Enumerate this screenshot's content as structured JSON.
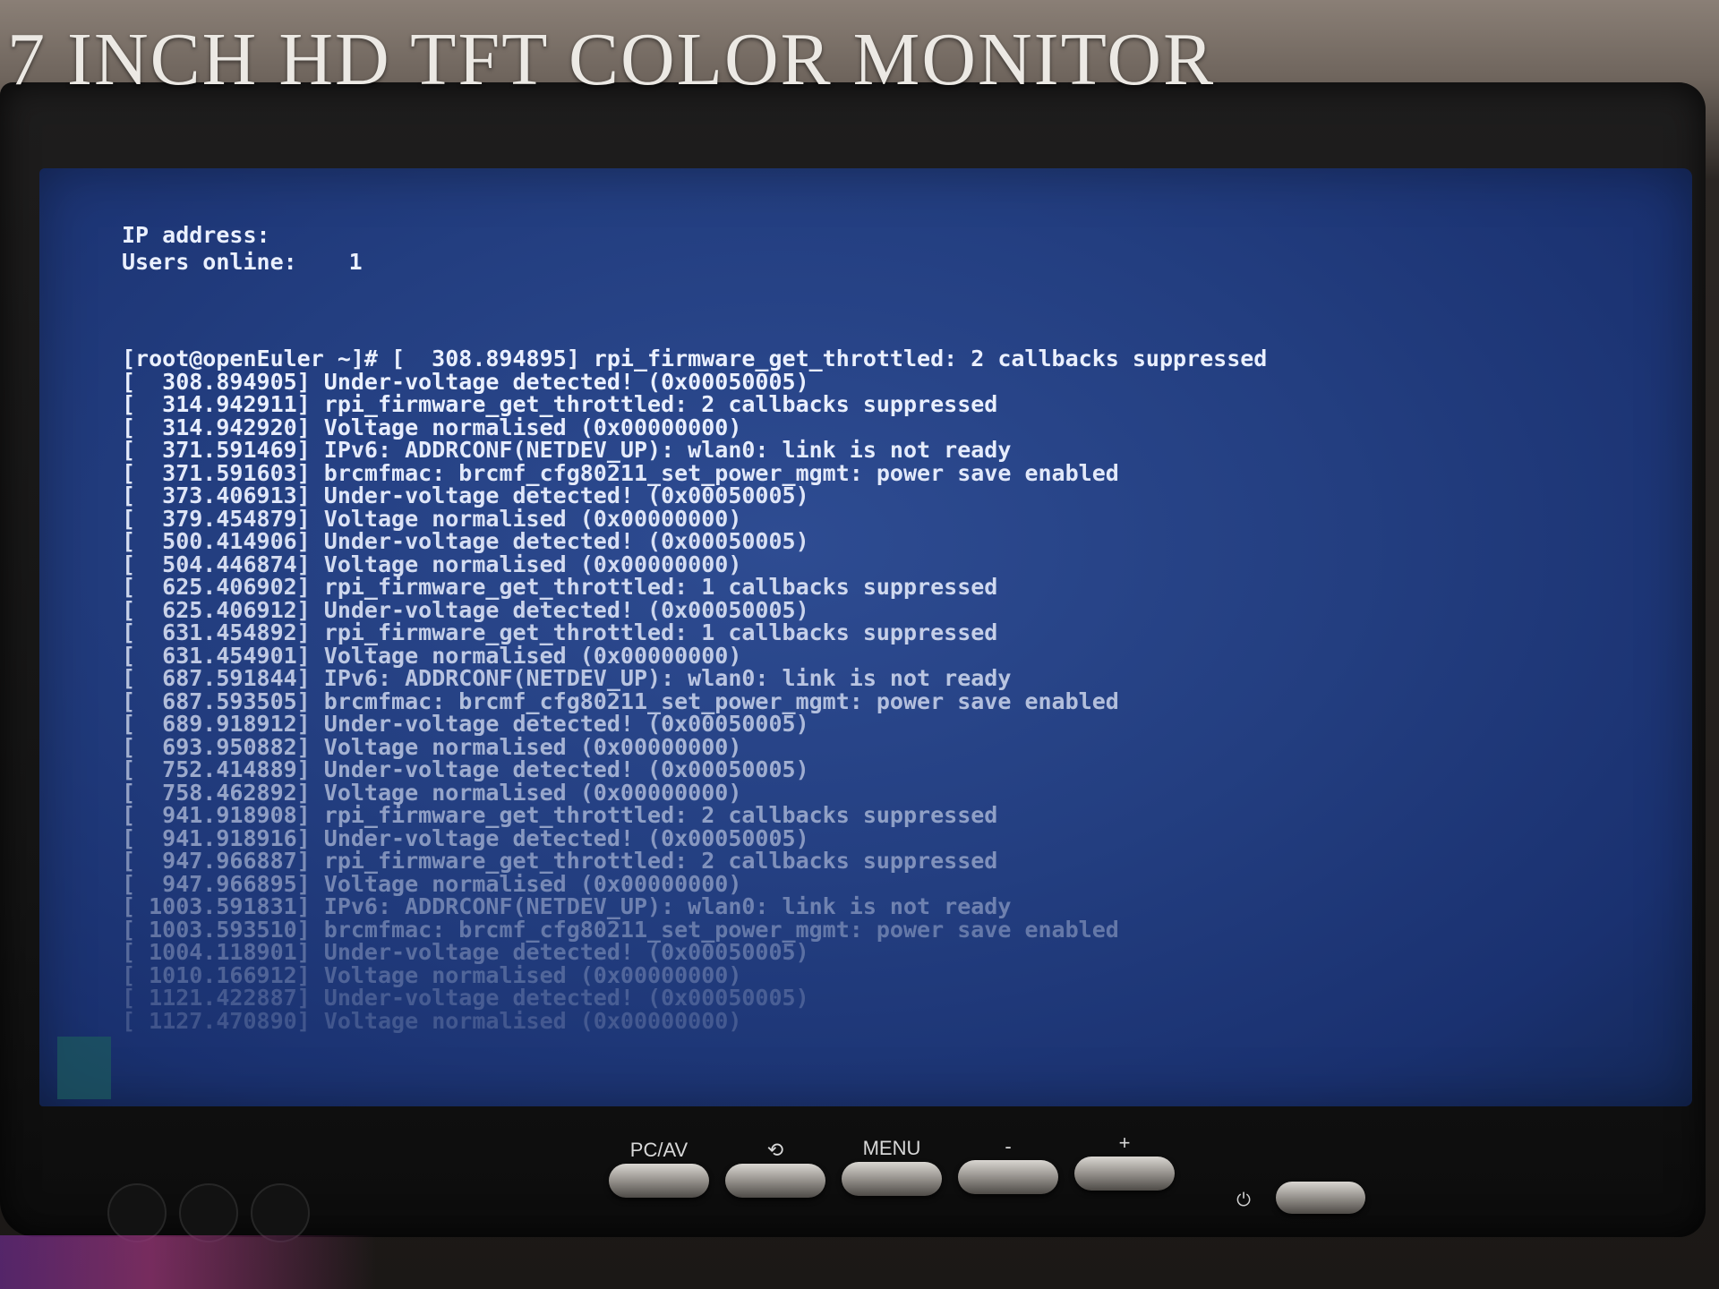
{
  "monitor": {
    "brand_title": "7 INCH HD TFT COLOR MONITOR"
  },
  "terminal": {
    "status": [
      {
        "label": "IP address:",
        "value": ""
      },
      {
        "label": "Users online:",
        "value": "1"
      }
    ],
    "prompt": "[root@openEuler ~]# [  308.894895] rpi_firmware_get_throttled: 2 callbacks suppressed",
    "log_lines": [
      {
        "ts": "[  308.894905]",
        "msg": "Under-voltage detected! (0x00050005)"
      },
      {
        "ts": "[  314.942911]",
        "msg": "rpi_firmware_get_throttled: 2 callbacks suppressed"
      },
      {
        "ts": "[  314.942920]",
        "msg": "Voltage normalised (0x00000000)"
      },
      {
        "ts": "[  371.591469]",
        "msg": "IPv6: ADDRCONF(NETDEV_UP): wlan0: link is not ready"
      },
      {
        "ts": "[  371.591603]",
        "msg": "brcmfmac: brcmf_cfg80211_set_power_mgmt: power save enabled"
      },
      {
        "ts": "[  373.406913]",
        "msg": "Under-voltage detected! (0x00050005)"
      },
      {
        "ts": "[  379.454879]",
        "msg": "Voltage normalised (0x00000000)"
      },
      {
        "ts": "[  500.414906]",
        "msg": "Under-voltage detected! (0x00050005)"
      },
      {
        "ts": "[  504.446874]",
        "msg": "Voltage normalised (0x00000000)"
      },
      {
        "ts": "[  625.406902]",
        "msg": "rpi_firmware_get_throttled: 1 callbacks suppressed"
      },
      {
        "ts": "[  625.406912]",
        "msg": "Under-voltage detected! (0x00050005)"
      },
      {
        "ts": "[  631.454892]",
        "msg": "rpi_firmware_get_throttled: 1 callbacks suppressed"
      },
      {
        "ts": "[  631.454901]",
        "msg": "Voltage normalised (0x00000000)"
      },
      {
        "ts": "[  687.591844]",
        "msg": "IPv6: ADDRCONF(NETDEV_UP): wlan0: link is not ready"
      },
      {
        "ts": "[  687.593505]",
        "msg": "brcmfmac: brcmf_cfg80211_set_power_mgmt: power save enabled"
      },
      {
        "ts": "[  689.918912]",
        "msg": "Under-voltage detected! (0x00050005)"
      },
      {
        "ts": "[  693.950882]",
        "msg": "Voltage normalised (0x00000000)"
      },
      {
        "ts": "[  752.414889]",
        "msg": "Under-voltage detected! (0x00050005)"
      },
      {
        "ts": "[  758.462892]",
        "msg": "Voltage normalised (0x00000000)"
      },
      {
        "ts": "[  941.918908]",
        "msg": "rpi_firmware_get_throttled: 2 callbacks suppressed"
      },
      {
        "ts": "[  941.918916]",
        "msg": "Under-voltage detected! (0x00050005)"
      },
      {
        "ts": "[  947.966887]",
        "msg": "rpi_firmware_get_throttled: 2 callbacks suppressed"
      },
      {
        "ts": "[  947.966895]",
        "msg": "Voltage normalised (0x00000000)"
      },
      {
        "ts": "[ 1003.591831]",
        "msg": "IPv6: ADDRCONF(NETDEV_UP): wlan0: link is not ready"
      },
      {
        "ts": "[ 1003.593510]",
        "msg": "brcmfmac: brcmf_cfg80211_set_power_mgmt: power save enabled"
      },
      {
        "ts": "[ 1004.118901]",
        "msg": "Under-voltage detected! (0x00050005)"
      },
      {
        "ts": "[ 1010.166912]",
        "msg": "Voltage normalised (0x00000000)"
      },
      {
        "ts": "[ 1121.422887]",
        "msg": "Under-voltage detected! (0x00050005)"
      },
      {
        "ts": "[ 1127.470890]",
        "msg": "Voltage normalised (0x00000000)"
      }
    ]
  },
  "controls": [
    {
      "label": "PC/AV",
      "name": "pc-av-button"
    },
    {
      "label": "⟲",
      "name": "rotate-button"
    },
    {
      "label": "MENU",
      "name": "menu-button"
    },
    {
      "label": "-",
      "name": "minus-button"
    },
    {
      "label": "+",
      "name": "plus-button"
    }
  ],
  "power": {
    "icon": "power-icon",
    "glyph": "⏻"
  },
  "colors": {
    "screen_bg": "#233e80",
    "terminal_text": "#eaf0ff",
    "bezel": "#141414"
  }
}
